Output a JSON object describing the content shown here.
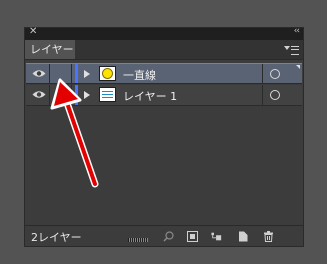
{
  "panel": {
    "close_glyph": "✕",
    "collapse_glyph": "‹‹",
    "tab_label": "レイヤー",
    "menu_icon": "panel-menu-icon"
  },
  "layers": [
    {
      "name": "一直線",
      "thumb": "yellow-circle",
      "selected": true
    },
    {
      "name": "レイヤー 1",
      "thumb": "lines",
      "selected": false
    }
  ],
  "footer": {
    "count_label": "2レイヤー"
  },
  "colors": {
    "selection": "#5a6374",
    "layer_color": "#4a73ff",
    "annotation_arrow": "#e20000"
  }
}
